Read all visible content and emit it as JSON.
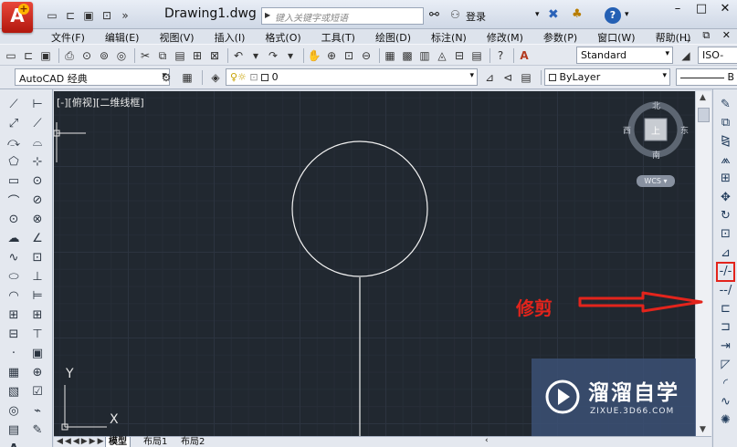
{
  "titlebar": {
    "logo_letter": "A",
    "document_title": "Drawing1.dwg",
    "search_placeholder": "键入关键字或短语",
    "login_label": "登录",
    "help_label": "?",
    "minimize": "–",
    "maximize": "□",
    "close": "✕"
  },
  "menubar": {
    "items": [
      "文件(F)",
      "编辑(E)",
      "视图(V)",
      "插入(I)",
      "格式(O)",
      "工具(T)",
      "绘图(D)",
      "标注(N)",
      "修改(M)",
      "参数(P)",
      "窗口(W)",
      "帮助(H)"
    ],
    "mdi_buttons": "_ ⧉ ✕"
  },
  "toolbar1": {
    "text_style": "Standard",
    "dim_style": "ISO-"
  },
  "toolbar2": {
    "workspace": "AutoCAD 经典",
    "layer_name": "0",
    "color": "ByLayer",
    "linetype": "B"
  },
  "canvas": {
    "viewport_label": "[-][俯视][二维线框]",
    "viewcube": {
      "top": "上",
      "north": "北",
      "south": "南",
      "east": "东",
      "west": "西"
    },
    "wcs_label": "WCS",
    "ucs_y": "Y",
    "ucs_x": "X",
    "background": "#212830",
    "entity_color": "#ffffff"
  },
  "tabs": {
    "nav": "◀◀◀▶▶▶",
    "model": "模型",
    "layout1": "布局1",
    "layout2": "布局2"
  },
  "annotation": {
    "text": "修剪",
    "color": "#e3241c"
  },
  "watermark": {
    "name": "溜溜自学",
    "url": "ZIXUE.3D66.COM"
  }
}
